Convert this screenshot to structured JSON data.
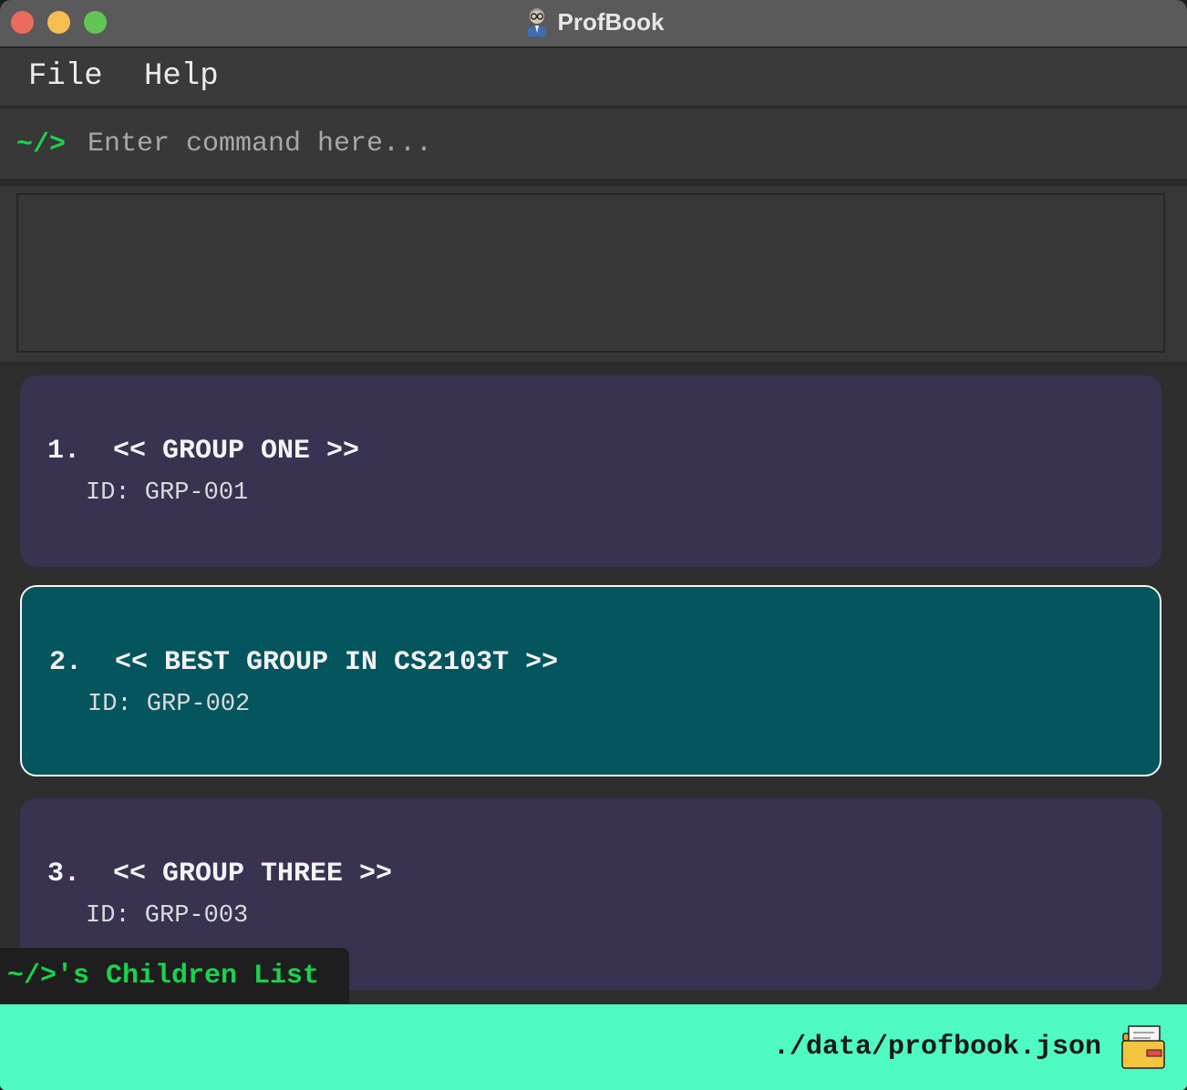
{
  "window": {
    "title": "ProfBook"
  },
  "menu": {
    "items": [
      {
        "label": "File"
      },
      {
        "label": "Help"
      }
    ]
  },
  "command": {
    "prompt": "~/>",
    "value": "",
    "placeholder": "Enter command here..."
  },
  "result": {
    "text": ""
  },
  "list": {
    "label": "~/>'s Children List",
    "cards": [
      {
        "index": "1.",
        "name": "GROUP ONE",
        "title": "1.  << GROUP ONE >>",
        "id": "ID: GRP-001",
        "selected": false
      },
      {
        "index": "2.",
        "name": "BEST GROUP IN CS2103T",
        "title": "2.  << BEST GROUP IN CS2103T >>",
        "id": "ID: GRP-002",
        "selected": true
      },
      {
        "index": "3.",
        "name": "GROUP THREE",
        "title": "3.  << GROUP THREE >>",
        "id": "ID: GRP-003",
        "selected": false
      }
    ]
  },
  "status": {
    "path": "./data/profbook.json",
    "icon": "folder-icon"
  },
  "colors": {
    "prompt_green": "#19d34e",
    "card_bg": "#3a3251",
    "card_selected_bg": "#04555e",
    "status_bg": "#4ffac2"
  }
}
